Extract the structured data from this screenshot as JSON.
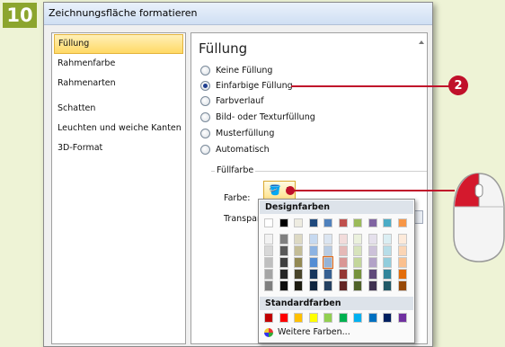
{
  "step_badge": "10",
  "dialog": {
    "title": "Zeichnungsfläche formatieren"
  },
  "sidebar": {
    "items": [
      {
        "label": "Füllung",
        "selected": true
      },
      {
        "label": "Rahmenfarbe"
      },
      {
        "label": "Rahmenarten"
      },
      {
        "label": "Schatten"
      },
      {
        "label": "Leuchten und weiche Kanten"
      },
      {
        "label": "3D-Format"
      }
    ]
  },
  "panel": {
    "title": "Füllung",
    "options": [
      {
        "label": "Keine Füllung",
        "selected": false
      },
      {
        "label": "Einfarbige Füllung",
        "selected": true
      },
      {
        "label": "Farbverlauf",
        "selected": false
      },
      {
        "label": "Bild- oder Texturfüllung",
        "selected": false
      },
      {
        "label": "Musterfüllung",
        "selected": false
      },
      {
        "label": "Automatisch",
        "selected": false
      }
    ],
    "group_label": "Füllfarbe",
    "color_label": "Farbe:",
    "transparency_label": "Transpar"
  },
  "dropdown": {
    "theme_header": "Designfarben",
    "standard_header": "Standardfarben",
    "more_colors": "Weitere Farben...",
    "theme_top": [
      "#ffffff",
      "#000000",
      "#eeece1",
      "#1f497d",
      "#4f81bd",
      "#c0504d",
      "#9bbb59",
      "#8064a2",
      "#4bacc6",
      "#f79646"
    ],
    "theme_shades": [
      [
        "#f2f2f2",
        "#7f7f7f",
        "#ddd9c3",
        "#c6d9f0",
        "#dbe5f1",
        "#f2dcdb",
        "#ebf1dd",
        "#e5e0ec",
        "#dbeef3",
        "#fdeada"
      ],
      [
        "#d8d8d8",
        "#595959",
        "#c4bd97",
        "#8db3e2",
        "#b8cce4",
        "#e5b9b7",
        "#d7e3bc",
        "#ccc1d9",
        "#b7dde8",
        "#fbd5b5"
      ],
      [
        "#bfbfbf",
        "#3f3f3f",
        "#938953",
        "#548dd4",
        "#95b3d7",
        "#d99694",
        "#c3d69b",
        "#b2a2c7",
        "#92cddc",
        "#fac08f"
      ],
      [
        "#a5a5a5",
        "#262626",
        "#494429",
        "#17365d",
        "#366092",
        "#953734",
        "#76923c",
        "#5f497a",
        "#31859b",
        "#e36c09"
      ],
      [
        "#7f7f7f",
        "#0c0c0c",
        "#1d1b10",
        "#0f243e",
        "#244061",
        "#632423",
        "#4f6128",
        "#3f3151",
        "#205867",
        "#974806"
      ]
    ],
    "standard_colors": [
      "#c00000",
      "#ff0000",
      "#ffc000",
      "#ffff00",
      "#92d050",
      "#00b050",
      "#00b0f0",
      "#0070c0",
      "#002060",
      "#7030a0"
    ],
    "highlight": {
      "row": 2,
      "col": 4
    }
  },
  "callout": {
    "number": "2",
    "color": "#c0102a"
  }
}
